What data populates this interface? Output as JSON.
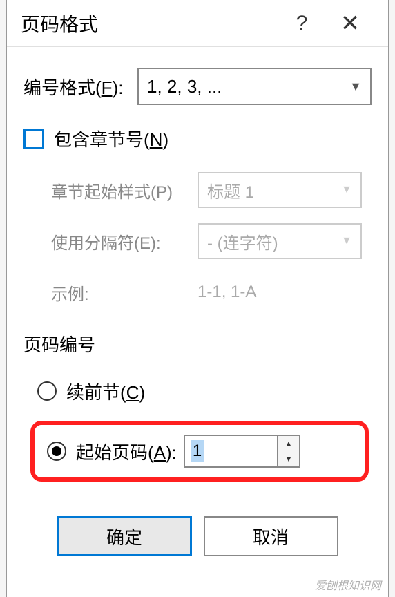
{
  "dialog": {
    "title": "页码格式",
    "help": "?",
    "close": "✕"
  },
  "format": {
    "label": "编号格式(",
    "accel": "F",
    "label_end": "):",
    "value": "1, 2, 3, ..."
  },
  "include_chapter": {
    "checked": false,
    "label": "包含章节号(",
    "accel": "N",
    "label_end": ")"
  },
  "chapter_style": {
    "label": "章节起始样式(P)",
    "value": "标题 1"
  },
  "separator": {
    "label": "使用分隔符(E):",
    "value": "-   (连字符)"
  },
  "example": {
    "label": "示例:",
    "value": "1-1, 1-A"
  },
  "numbering": {
    "section_title": "页码编号",
    "continue": {
      "label": "续前节(",
      "accel": "C",
      "label_end": ")",
      "selected": false
    },
    "start_at": {
      "label": "起始页码(",
      "accel": "A",
      "label_end": "):",
      "selected": true,
      "value": "1"
    }
  },
  "buttons": {
    "ok": "确定",
    "cancel": "取消"
  },
  "watermark": "爱刨根知识网"
}
